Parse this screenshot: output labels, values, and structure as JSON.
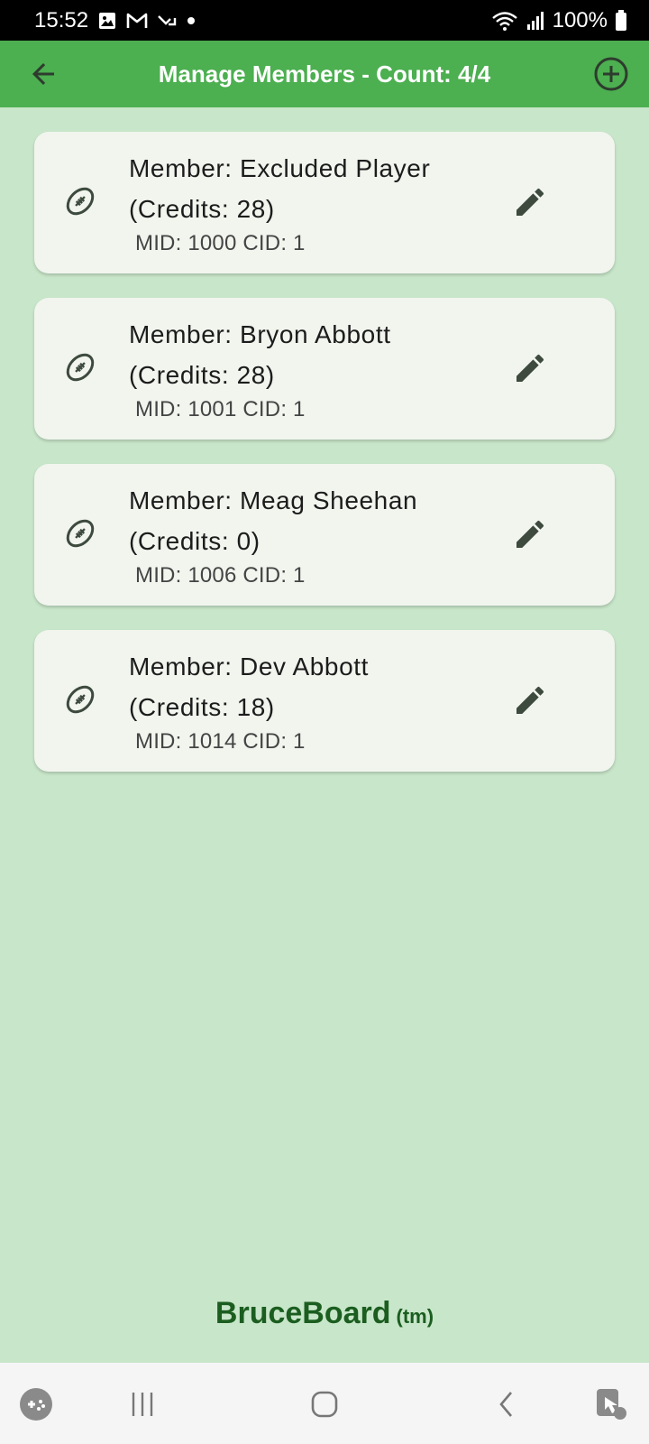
{
  "status_bar": {
    "time": "15:52",
    "battery": "100%",
    "icons": [
      "gallery-icon",
      "gmail-icon",
      "missed-call-icon",
      "dot-icon",
      "wifi-icon",
      "signal-icon",
      "battery-icon"
    ]
  },
  "app_bar": {
    "title": "Manage Members - Count: 4/4",
    "color": "#4caf50"
  },
  "members": [
    {
      "title": "Member: Excluded Player",
      "credits": "(Credits: 28)",
      "sub": "MID: 1000 CID: 1"
    },
    {
      "title": "Member: Bryon Abbott",
      "credits": "(Credits: 28)",
      "sub": "MID: 1001 CID: 1"
    },
    {
      "title": "Member: Meag Sheehan",
      "credits": "(Credits: 0)",
      "sub": "MID: 1006 CID: 1"
    },
    {
      "title": "Member: Dev Abbott",
      "credits": "(Credits: 18)",
      "sub": "MID: 1014 CID: 1"
    }
  ],
  "footer": {
    "brand": "BruceBoard",
    "tm": "(tm)",
    "color": "#1b5e20"
  },
  "colors": {
    "background": "#c8e6c9",
    "card": "#f1f5ee",
    "icon": "#3d4a3d"
  }
}
